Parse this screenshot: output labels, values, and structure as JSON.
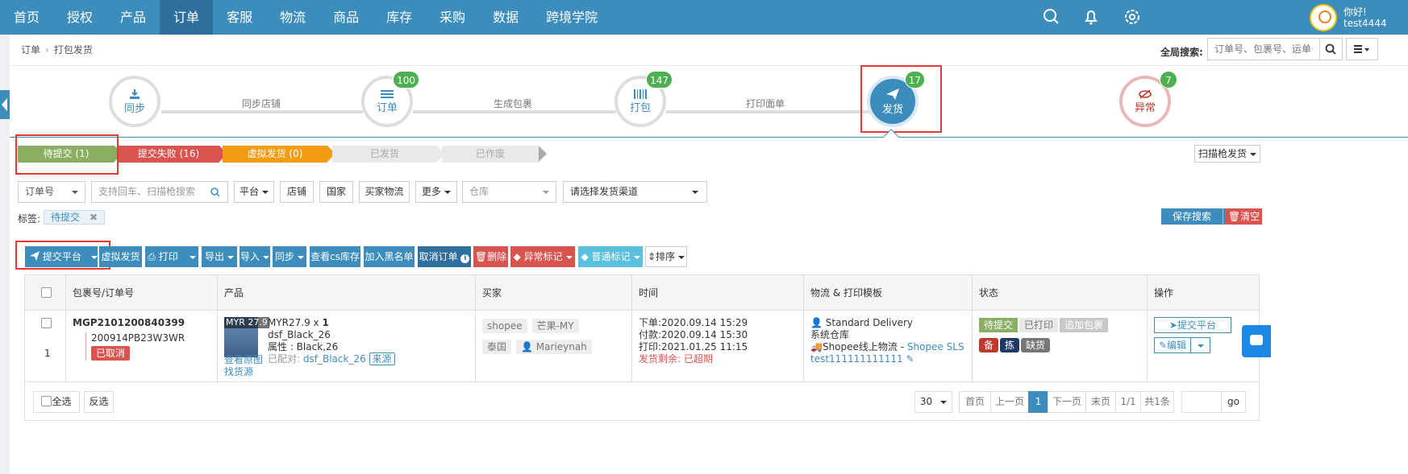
{
  "nav": {
    "items": [
      "首页",
      "授权",
      "产品",
      "订单",
      "客服",
      "物流",
      "商品",
      "库存",
      "采购",
      "数据",
      "跨境学院"
    ],
    "active_index": 3,
    "greeting": "你好!",
    "username": "test4444"
  },
  "breadcrumb": {
    "root": "订单",
    "current": "打包发货"
  },
  "global_search": {
    "label": "全局搜索:",
    "placeholder": "订单号、包裹号、运单号"
  },
  "steps": [
    {
      "label": "同步",
      "badge": ""
    },
    {
      "label": "订单",
      "badge": "100"
    },
    {
      "label": "打包",
      "badge": "147"
    },
    {
      "label": "发货",
      "badge": "17"
    },
    {
      "label": "异常",
      "badge": "7"
    }
  ],
  "step_links": [
    "同步店铺",
    "生成包裹",
    "打印面单"
  ],
  "status_tabs": [
    "待提交 (1)",
    "提交失败 (16)",
    "虚拟发货 (0)",
    "已发货",
    "已作废"
  ],
  "scan_button": "扫描枪发货",
  "filters": {
    "order_no": "订单号",
    "search_placeholder": "支持回车、扫描枪搜索",
    "platform": "平台",
    "shop": "店铺",
    "country": "国家",
    "buyer_logistics": "买家物流",
    "more": "更多",
    "warehouse": "仓库",
    "channel": "请选择发货渠道"
  },
  "tags": {
    "label": "标签:",
    "items": [
      "待提交"
    ]
  },
  "save_search": "保存搜索",
  "clear": "清空",
  "toolbar": {
    "submit_platform": "提交平台",
    "virtual_ship": "虚拟发货",
    "print": "打印",
    "export": "导出",
    "import": "导入",
    "sync": "同步",
    "cs_stock": "查看cs库存",
    "blacklist": "加入黑名单",
    "cancel_order": "取消订单",
    "delete": "删除",
    "abnormal_mark": "异常标记",
    "normal_mark": "普通标记",
    "sort": "排序"
  },
  "table": {
    "headers": [
      "包裹号/订单号",
      "产品",
      "买家",
      "时间",
      "物流 & 打印模板",
      "状态",
      "操作"
    ],
    "row": {
      "index": "1",
      "package_no": "MGP2101200840399",
      "order_no": "200914PB23W3WR",
      "cancelled": "已取消",
      "thumb_price": "MYR 27.9",
      "price_qty_prefix": "MYR27.9 x ",
      "qty": "1",
      "sku": "dsf_Black_26",
      "attr": "属性 : Black,26",
      "view_image": "查看原图",
      "find_source": "找货源",
      "matched_label": "已配对:",
      "matched_sku": "dsf_Black_26",
      "source_btn": "来源",
      "platform": "shopee",
      "shop": "芒果-MY",
      "country": "泰国",
      "buyer": "Marieynah",
      "order_time": "下单:2020.09.14 15:29",
      "pay_time": "付款:2020.09.14 15:30",
      "print_time": "打印:2021.01.25 11:15",
      "ship_remaining": "发货剩余: 已超期",
      "logistics": "Standard Delivery",
      "warehouse": "系统仓库",
      "logistics_provider_prefix": "Shopee线上物流 - ",
      "logistics_provider": "Shopee SLS",
      "tracking": "test111111111111",
      "status_pending": "待提交",
      "status_printed": "已打印",
      "status_append": "追加包裹",
      "mark_bei": "备",
      "mark_jian": "拣",
      "mark_que": "缺货",
      "action_submit": "提交平台",
      "action_edit": "编辑"
    }
  },
  "footer": {
    "select_all": "全选",
    "invert": "反选",
    "page_size": "30",
    "first": "首页",
    "prev": "上一页",
    "current": "1",
    "next": "下一页",
    "last": "末页",
    "page_info": "1/1",
    "total": "共1条",
    "go": "go"
  }
}
